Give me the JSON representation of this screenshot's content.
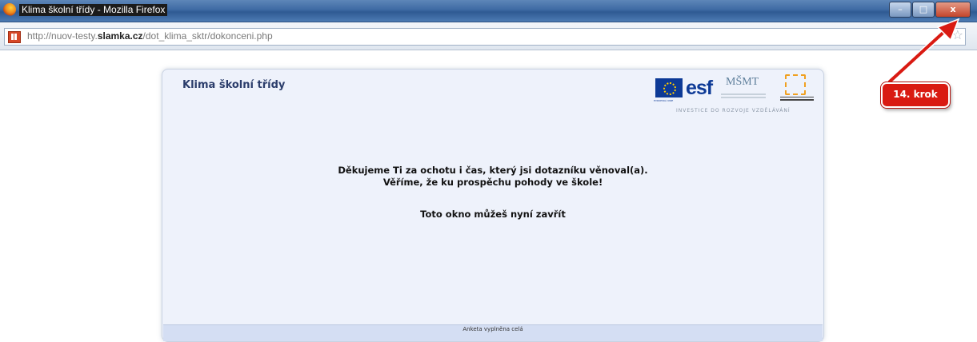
{
  "browser": {
    "window_title": "Klima školní třídy - Mozilla Firefox",
    "window_buttons": {
      "minimize": "–",
      "maximize": "□",
      "close": "x"
    },
    "url_prefix": "http://nuov-testy.",
    "url_domain": "slamka.cz",
    "url_path": "/dot_klima_sktr/dokonceni.php",
    "bookmark_icon": "☆"
  },
  "page": {
    "title": "Klima školní třídy",
    "logos": {
      "eu_caption": "EVROPSKÁ UNIE",
      "esf_text": "esf",
      "msmt_text": "MŠMT",
      "investice": "INVESTICE DO ROZVOJE VZDĚLÁVÁNÍ"
    },
    "message_line1": "Děkujeme Ti za ochotu i čas, který jsi dotazníku věnoval(a).",
    "message_line2": "Věříme, že ku prospěchu pohody ve škole!",
    "message_line3": "Toto okno můžeš nyní zavřít",
    "footer": "Anketa vyplněna celá"
  },
  "annotation": {
    "label": "14. krok",
    "color": "#d91a12"
  }
}
